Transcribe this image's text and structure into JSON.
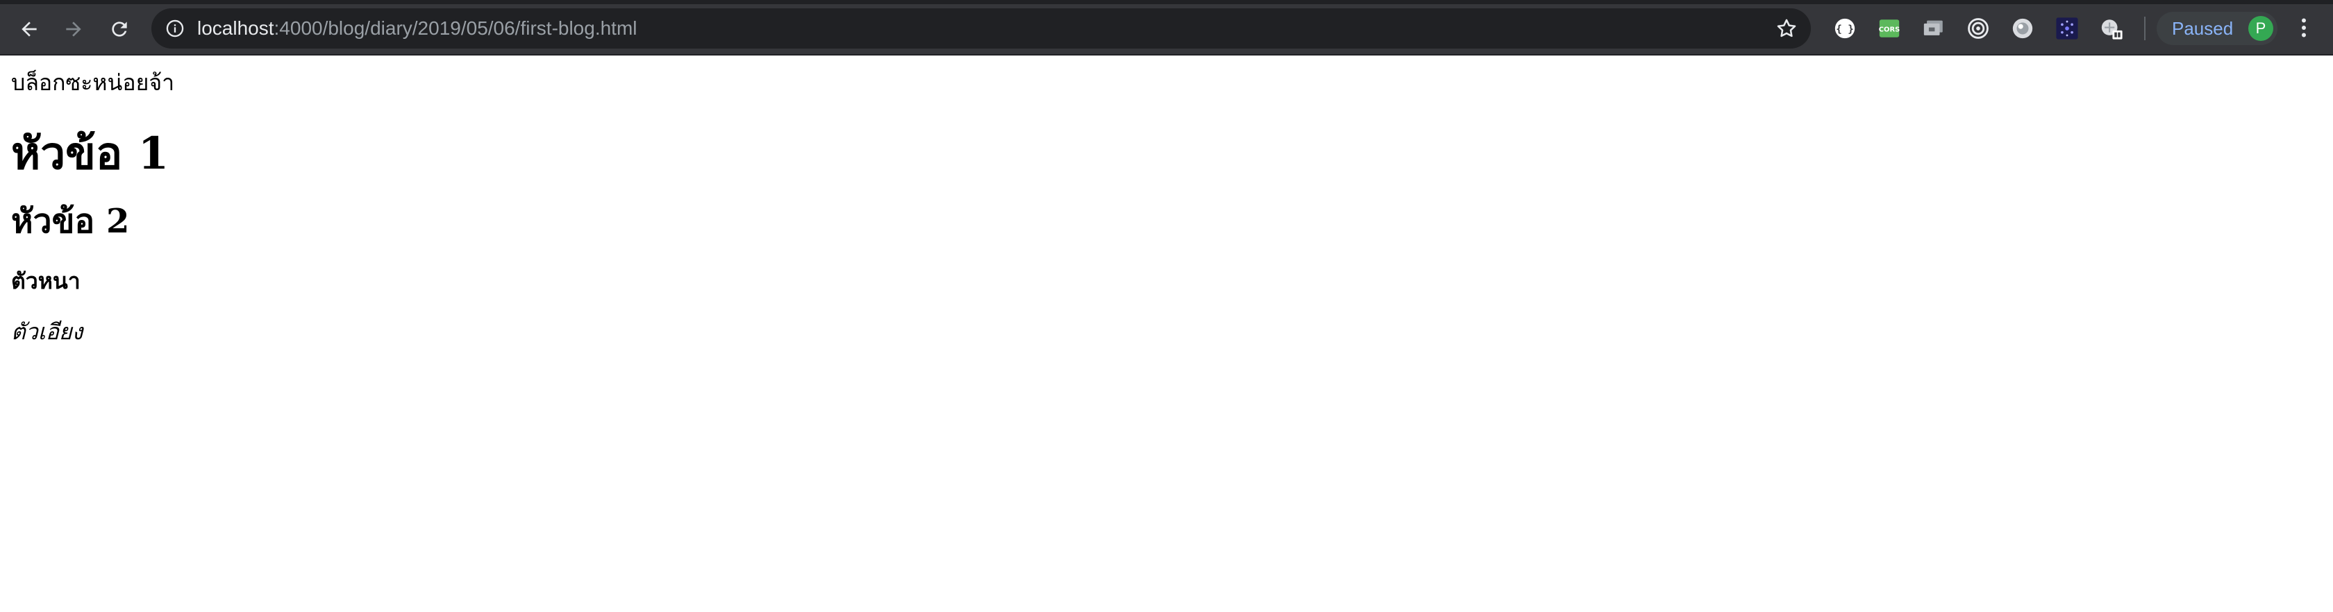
{
  "browser": {
    "url_host": "localhost",
    "url_path": ":4000/blog/diary/2019/05/06/first-blog.html",
    "profile_label": "Paused",
    "profile_initial": "P",
    "extensions": [
      {
        "name": "json-viewer-icon"
      },
      {
        "name": "cors-extension-icon",
        "text": "CORS"
      },
      {
        "name": "screenshot-extension-icon"
      },
      {
        "name": "target-extension-icon"
      },
      {
        "name": "circle-extension-icon"
      },
      {
        "name": "sparkle-extension-icon"
      },
      {
        "name": "puzzle-extension-icon"
      }
    ],
    "colors": {
      "toolbar": "#35363a",
      "omnibox": "#202124",
      "accent": "#8ab4f8",
      "avatar": "#34a853"
    }
  },
  "page": {
    "intro": "บล็อกซะหน่อยจ้า",
    "heading1": "หัวข้อ 1",
    "heading2": "หัวข้อ 2",
    "bold_text": "ตัวหนา",
    "italic_text": "ตัวเอียง"
  }
}
